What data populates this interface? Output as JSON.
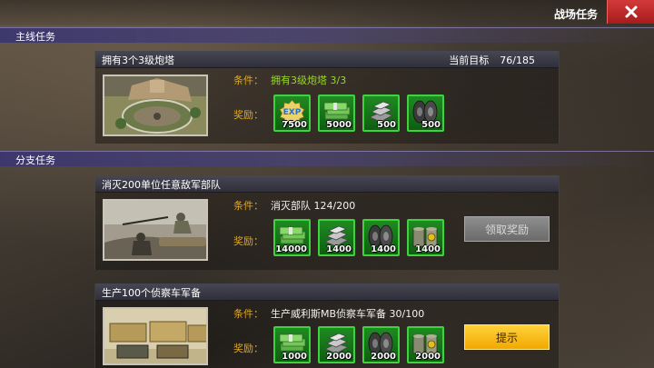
{
  "header": {
    "title": "战场任务",
    "close_icon": "close-icon"
  },
  "sections": {
    "main": {
      "label": "主线任务"
    },
    "branch": {
      "label": "分支任务"
    }
  },
  "labels": {
    "condition": "条件：",
    "reward": "奖励："
  },
  "main_task": {
    "title": "拥有3个3级炮塔",
    "progress_label": "当前目标",
    "progress_value": "76/185",
    "condition": "拥有3级炮塔 3/3",
    "rewards": [
      {
        "icon": "exp-badge-icon",
        "amount": "7500"
      },
      {
        "icon": "cash-icon",
        "amount": "5000"
      },
      {
        "icon": "steel-icon",
        "amount": "500"
      },
      {
        "icon": "tire-icon",
        "amount": "500"
      }
    ]
  },
  "branch_tasks": [
    {
      "title": "消灭200单位任意敌军部队",
      "condition": "消灭部队 124/200",
      "button_label": "领取奖励",
      "rewards": [
        {
          "icon": "cash-icon",
          "amount": "14000"
        },
        {
          "icon": "steel-icon",
          "amount": "1400"
        },
        {
          "icon": "tire-icon",
          "amount": "1400"
        },
        {
          "icon": "oil-barrel-icon",
          "amount": "1400"
        }
      ]
    },
    {
      "title": "生产100个侦察车军备",
      "condition": "生产威利斯MB侦察车军备 30/100",
      "button_label": "提示",
      "rewards": [
        {
          "icon": "cash-icon",
          "amount": "1000"
        },
        {
          "icon": "steel-icon",
          "amount": "2000"
        },
        {
          "icon": "tire-icon",
          "amount": "2000"
        },
        {
          "icon": "oil-barrel-icon",
          "amount": "2000"
        }
      ]
    }
  ],
  "colors": {
    "section_header": "#3c376e",
    "reward_border": "#3fd23f",
    "condition_green": "#9ad62a",
    "label_gold": "#e0a820",
    "claim_button": "#7c7c7c",
    "hint_button": "#f2b400",
    "close_button": "#c02a2a"
  }
}
